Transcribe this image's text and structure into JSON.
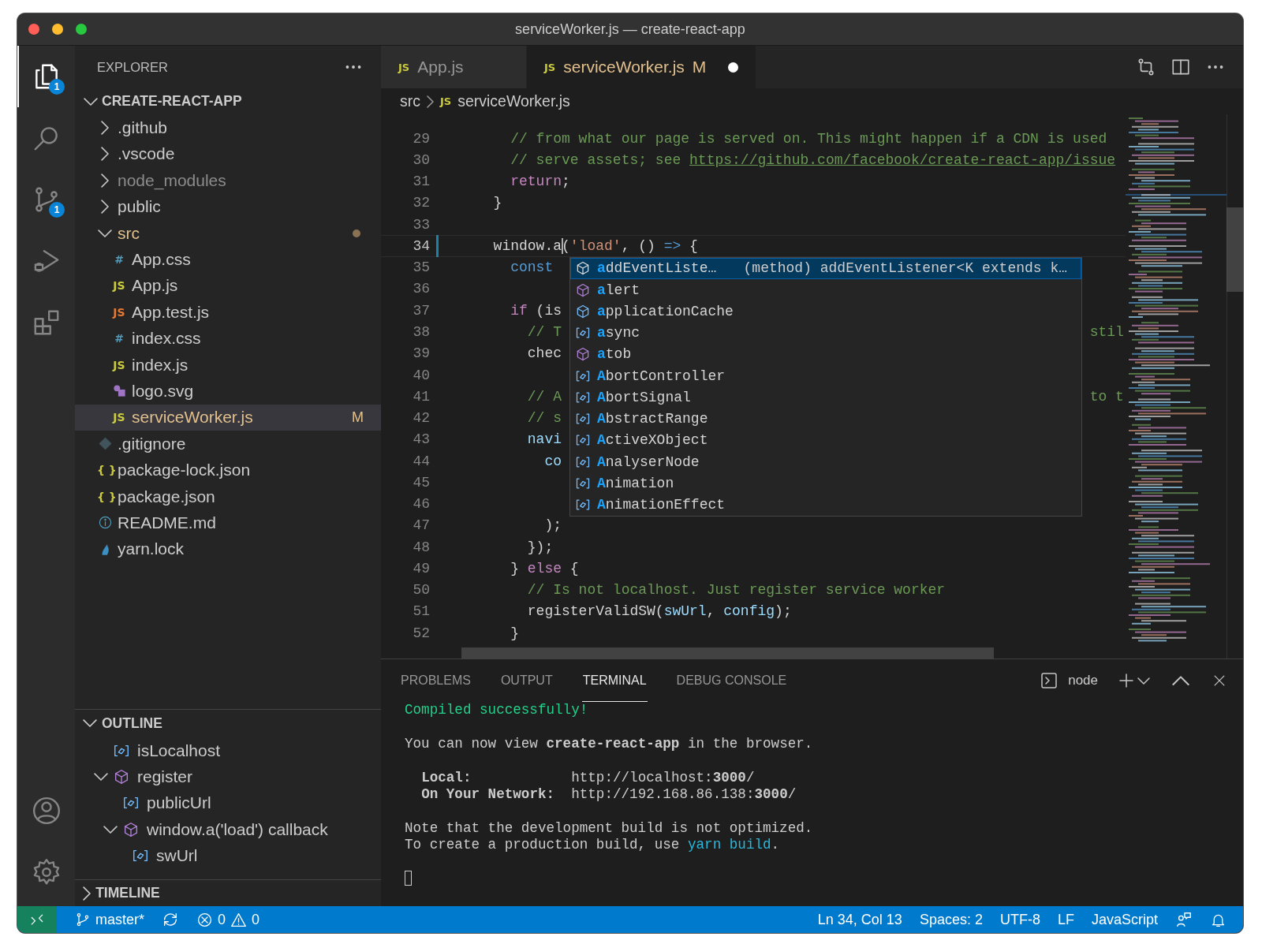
{
  "window": {
    "title": "serviceWorker.js — create-react-app"
  },
  "activity_bar": {
    "items": [
      {
        "kind": "explorer",
        "selected": true,
        "badge": "1"
      },
      {
        "kind": "search",
        "selected": false
      },
      {
        "kind": "source-control",
        "selected": false,
        "badge": "1"
      },
      {
        "kind": "run",
        "selected": false
      },
      {
        "kind": "extensions",
        "selected": false
      }
    ],
    "bottom": [
      {
        "kind": "account"
      },
      {
        "kind": "settings"
      }
    ]
  },
  "sidebar": {
    "title": "EXPLORER",
    "root": {
      "label": "CREATE-REACT-APP",
      "kind": "folder",
      "expanded": true,
      "selected": false,
      "ignored": false,
      "modified": false,
      "children": [
        {
          "label": ".github",
          "kind": "folder",
          "expanded": false,
          "selected": false,
          "ignored": false,
          "modified": false
        },
        {
          "label": ".vscode",
          "kind": "folder",
          "expanded": false,
          "selected": false,
          "ignored": false,
          "modified": false
        },
        {
          "label": "node_modules",
          "kind": "folder",
          "expanded": false,
          "selected": false,
          "ignored": true,
          "modified": false
        },
        {
          "label": "public",
          "kind": "folder",
          "expanded": false,
          "selected": false,
          "ignored": false,
          "modified": false
        },
        {
          "label": "src",
          "kind": "folder",
          "expanded": true,
          "selected": false,
          "ignored": false,
          "modified": true,
          "children": [
            {
              "label": "App.css",
              "kind": "css",
              "icon": "#",
              "selected": false,
              "ignored": false,
              "modified": false
            },
            {
              "label": "App.js",
              "kind": "js",
              "icon": "JS",
              "selected": false,
              "ignored": false,
              "modified": false
            },
            {
              "label": "App.test.js",
              "kind": "test",
              "icon": "JS",
              "selected": false,
              "ignored": false,
              "modified": false
            },
            {
              "label": "index.css",
              "kind": "css",
              "icon": "#",
              "selected": false,
              "ignored": false,
              "modified": false
            },
            {
              "label": "index.js",
              "kind": "js",
              "icon": "JS",
              "selected": false,
              "ignored": false,
              "modified": false
            },
            {
              "label": "logo.svg",
              "kind": "svg",
              "selected": false,
              "ignored": false,
              "modified": false
            },
            {
              "label": "serviceWorker.js",
              "kind": "js",
              "icon": "JS",
              "selected": true,
              "ignored": false,
              "modified": true,
              "badge": "M"
            }
          ]
        },
        {
          "label": ".gitignore",
          "kind": "git",
          "selected": false,
          "ignored": false,
          "modified": false
        },
        {
          "label": "package-lock.json",
          "kind": "json",
          "icon": "{ }",
          "selected": false,
          "ignored": false,
          "modified": false
        },
        {
          "label": "package.json",
          "kind": "json",
          "icon": "{ }",
          "selected": false,
          "ignored": false,
          "modified": false
        },
        {
          "label": "README.md",
          "kind": "info",
          "selected": false,
          "ignored": false,
          "modified": false
        },
        {
          "label": "yarn.lock",
          "kind": "yarn",
          "selected": false,
          "ignored": false,
          "modified": false
        }
      ]
    },
    "outline": {
      "title": "OUTLINE",
      "expanded": true,
      "items": [
        {
          "label": "isLocalhost",
          "kind": "variable"
        },
        {
          "label": "register",
          "kind": "function",
          "expanded": true,
          "children": [
            {
              "label": "publicUrl",
              "kind": "variable"
            },
            {
              "label": "window.a('load') callback",
              "kind": "function",
              "expanded": true,
              "children": [
                {
                  "label": "swUrl",
                  "kind": "variable"
                }
              ]
            }
          ]
        }
      ]
    },
    "timeline": {
      "title": "TIMELINE",
      "expanded": false
    }
  },
  "editor": {
    "tabs": [
      {
        "label": "App.js",
        "icon": "JS",
        "selected": false,
        "modified": false,
        "dirty": false
      },
      {
        "label": "serviceWorker.js",
        "icon": "JS",
        "selected": true,
        "modified": true,
        "badge": "M",
        "dirty": true
      }
    ],
    "breadcrumb": [
      {
        "label": "src"
      },
      {
        "label": "serviceWorker.js",
        "icon": "JS"
      }
    ],
    "lines": [
      {
        "number": "29",
        "current": false,
        "modified": false,
        "tokens": [
          {
            "text": "    // from what our page is served on. This might happen if a CDN is used",
            "kind": "comment"
          }
        ]
      },
      {
        "number": "30",
        "current": false,
        "modified": false,
        "tokens": [
          {
            "text": "    // serve assets; see ",
            "kind": "comment"
          },
          {
            "text": "https://github.com/facebook/create-react-app/issue",
            "kind": "link"
          }
        ]
      },
      {
        "number": "31",
        "current": false,
        "modified": false,
        "tokens": [
          {
            "text": "    return",
            "kind": "keyword"
          },
          {
            "text": ";",
            "kind": "plain"
          }
        ]
      },
      {
        "number": "32",
        "current": false,
        "modified": false,
        "tokens": [
          {
            "text": "  }",
            "kind": "plain"
          }
        ]
      },
      {
        "number": "33",
        "current": false,
        "modified": false
      },
      {
        "number": "34",
        "current": true,
        "modified": true,
        "tokens": [
          {
            "text": "  window.",
            "kind": "plain"
          },
          {
            "text": "a",
            "kind": "plain",
            "cursor_after": true
          },
          {
            "text": "(",
            "kind": "plain"
          },
          {
            "text": "'load'",
            "kind": "string"
          },
          {
            "text": ", () ",
            "kind": "plain"
          },
          {
            "text": "=>",
            "kind": "storage"
          },
          {
            "text": " {",
            "kind": "plain"
          }
        ]
      },
      {
        "number": "35",
        "current": false,
        "modified": false,
        "tokens": [
          {
            "text": "    const",
            "kind": "storage"
          }
        ]
      },
      {
        "number": "36",
        "current": false,
        "modified": false
      },
      {
        "number": "37",
        "current": false,
        "modified": false,
        "tokens": [
          {
            "text": "    if",
            "kind": "keyword"
          },
          {
            "text": " (is",
            "kind": "plain"
          }
        ]
      },
      {
        "number": "38",
        "current": false,
        "modified": false,
        "tokens": [
          {
            "text": "      // T",
            "kind": "comment"
          }
        ],
        "tail": {
          "text": "stil",
          "kind": "comment"
        }
      },
      {
        "number": "39",
        "current": false,
        "modified": false,
        "tokens": [
          {
            "text": "      chec",
            "kind": "plain"
          }
        ]
      },
      {
        "number": "40",
        "current": false,
        "modified": false
      },
      {
        "number": "41",
        "current": false,
        "modified": false,
        "tokens": [
          {
            "text": "      // A",
            "kind": "comment"
          }
        ],
        "tail": {
          "text": "to t",
          "kind": "comment"
        }
      },
      {
        "number": "42",
        "current": false,
        "modified": false,
        "tokens": [
          {
            "text": "      // s",
            "kind": "comment"
          }
        ]
      },
      {
        "number": "43",
        "current": false,
        "modified": false,
        "tokens": [
          {
            "text": "      navi",
            "kind": "param"
          }
        ]
      },
      {
        "number": "44",
        "current": false,
        "modified": false,
        "tokens": [
          {
            "text": "        co",
            "kind": "param"
          }
        ]
      },
      {
        "number": "45",
        "current": false,
        "modified": false
      },
      {
        "number": "46",
        "current": false,
        "modified": false
      },
      {
        "number": "47",
        "current": false,
        "modified": false,
        "tokens": [
          {
            "text": "        );",
            "kind": "plain"
          }
        ]
      },
      {
        "number": "48",
        "current": false,
        "modified": false,
        "tokens": [
          {
            "text": "      });",
            "kind": "plain"
          }
        ]
      },
      {
        "number": "49",
        "current": false,
        "modified": false,
        "tokens": [
          {
            "text": "    } ",
            "kind": "plain"
          },
          {
            "text": "else",
            "kind": "keyword"
          },
          {
            "text": " {",
            "kind": "plain"
          }
        ]
      },
      {
        "number": "50",
        "current": false,
        "modified": false,
        "tokens": [
          {
            "text": "      // Is not localhost. Just register service worker",
            "kind": "comment"
          }
        ]
      },
      {
        "number": "51",
        "current": false,
        "modified": false,
        "tokens": [
          {
            "text": "      registerValidSW(",
            "kind": "plain"
          },
          {
            "text": "swUrl",
            "kind": "param"
          },
          {
            "text": ", ",
            "kind": "plain"
          },
          {
            "text": "config",
            "kind": "param"
          },
          {
            "text": ");",
            "kind": "plain"
          }
        ]
      },
      {
        "number": "52",
        "current": false,
        "modified": false,
        "tokens": [
          {
            "text": "    }",
            "kind": "plain"
          }
        ]
      }
    ],
    "suggestions": [
      {
        "label": "**a**ddEventListe…",
        "kind": "method",
        "selected": true,
        "detail": "(method) addEventListener<K extends k…"
      },
      {
        "label": "**a**lert",
        "kind": "function",
        "selected": false
      },
      {
        "label": "**a**pplicationCache",
        "kind": "property",
        "selected": false
      },
      {
        "label": "**a**sync",
        "kind": "variable",
        "selected": false
      },
      {
        "label": "**a**tob",
        "kind": "function",
        "selected": false
      },
      {
        "label": "**A**bortController",
        "kind": "variable",
        "selected": false
      },
      {
        "label": "**A**bortSignal",
        "kind": "variable",
        "selected": false
      },
      {
        "label": "**A**bstractRange",
        "kind": "variable",
        "selected": false
      },
      {
        "label": "**A**ctiveXObject",
        "kind": "variable",
        "selected": false
      },
      {
        "label": "**A**nalyserNode",
        "kind": "variable",
        "selected": false
      },
      {
        "label": "**A**nimation",
        "kind": "variable",
        "selected": false
      },
      {
        "label": "**A**nimationEffect",
        "kind": "variable",
        "selected": false
      }
    ]
  },
  "panel": {
    "tabs": [
      {
        "label": "PROBLEMS",
        "selected": false
      },
      {
        "label": "OUTPUT",
        "selected": false
      },
      {
        "label": "TERMINAL",
        "selected": true
      },
      {
        "label": "DEBUG CONSOLE",
        "selected": false
      }
    ],
    "terminal_name": "node",
    "terminal": [
      [
        [
          {
            "text": "Compiled successfully!",
            "kind": "success"
          }
        ]
      ],
      [
        [
          {
            "text": "You can now view **create-react-app** in the browser.",
            "kind": "plain"
          }
        ]
      ],
      [
        [
          {
            "text": "  **Local:**            http://localhost:**3000**/",
            "kind": "plain"
          }
        ],
        [
          {
            "text": "  **On Your Network:**  http://192.168.86.138:**3000**/",
            "kind": "plain"
          }
        ]
      ],
      [
        [
          {
            "text": "Note that the development build is not optimized.",
            "kind": "plain"
          }
        ],
        [
          {
            "text": "To create a production build, use ",
            "kind": "plain"
          },
          {
            "text": "yarn build",
            "kind": "command"
          },
          {
            "text": ".",
            "kind": "plain"
          }
        ]
      ]
    ]
  },
  "status_bar": {
    "left": [
      {
        "kind": "remote"
      },
      {
        "kind": "branch",
        "label": "master*"
      },
      {
        "kind": "sync"
      },
      {
        "kind": "problems",
        "errors": "0",
        "warnings": "0"
      }
    ],
    "right": [
      {
        "kind": "text",
        "label": "Ln 34, Col 13"
      },
      {
        "kind": "text",
        "label": "Spaces: 2"
      },
      {
        "kind": "text",
        "label": "UTF-8"
      },
      {
        "kind": "text",
        "label": "LF"
      },
      {
        "kind": "text",
        "label": "JavaScript"
      },
      {
        "kind": "feedback"
      },
      {
        "kind": "bell"
      }
    ]
  }
}
